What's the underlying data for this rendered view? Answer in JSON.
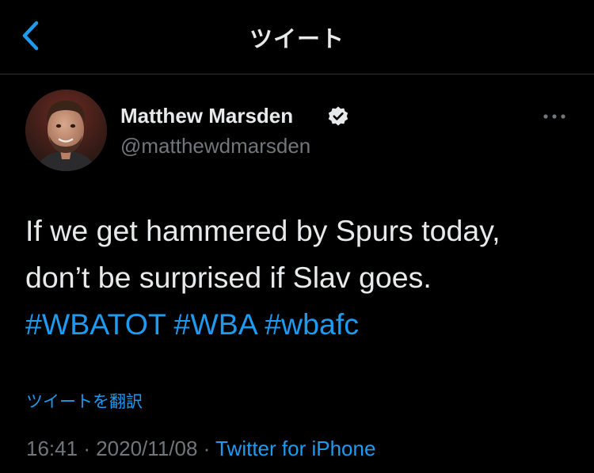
{
  "header": {
    "title": "ツイート",
    "back_icon": "chevron-left-icon"
  },
  "author": {
    "name": "Matthew Marsden",
    "handle": "@matthewdmarsden",
    "verified_icon": "verified-badge-icon",
    "avatar_icon": "user-avatar"
  },
  "more_icon": "ellipsis-icon",
  "tweet": {
    "line1": "If we get hammered by Spurs today,",
    "line2": "don’t be surprised if Slav goes.",
    "hashtags": [
      "#WBATOT",
      "#WBA",
      "#wbafc"
    ]
  },
  "translate_label": "ツイートを翻訳",
  "meta": {
    "time": "16:41",
    "separator": "·",
    "date": "2020/11/08",
    "source": "Twitter for iPhone"
  },
  "colors": {
    "background": "#000000",
    "text": "#e7e9ea",
    "secondary_text": "#71767b",
    "accent": "#1d9bf0"
  }
}
